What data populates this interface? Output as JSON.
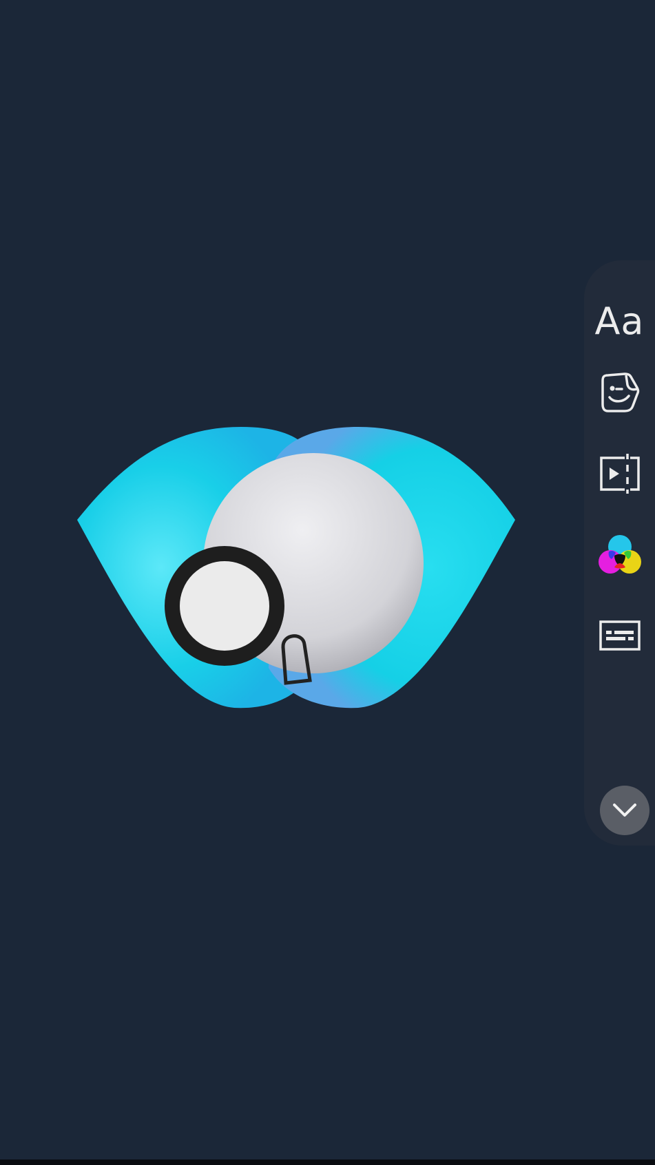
{
  "canvas": {
    "background": "#1b2738",
    "sticker": {
      "name": "eye-emoji",
      "colors": {
        "iris": "#19d3ee",
        "eyeball": "#d9d9dc",
        "outline": "#1e1e1e"
      }
    }
  },
  "toolbar": {
    "tools": [
      {
        "id": "text",
        "label": "Aa",
        "icon": "text-icon"
      },
      {
        "id": "sticker",
        "icon": "sticker-icon"
      },
      {
        "id": "trim",
        "icon": "trim-icon"
      },
      {
        "id": "filters",
        "icon": "filter-color-icon",
        "colors": [
          "#25c6ea",
          "#e51fe0",
          "#f4dd14"
        ]
      },
      {
        "id": "captions",
        "icon": "captions-icon"
      }
    ],
    "collapse": {
      "icon": "chevron-down-icon"
    }
  }
}
